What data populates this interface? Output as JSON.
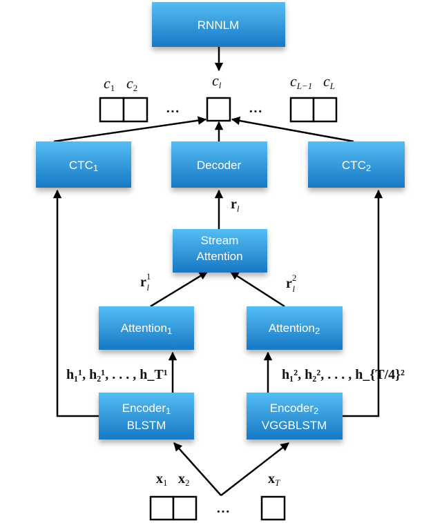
{
  "colors": {
    "box_top": "#55bdf2",
    "box_bottom": "#1778c4",
    "line": "#000000"
  },
  "boxes": {
    "rnnlm": "RNNLM",
    "ctc1": {
      "base": "CTC",
      "sub": "1"
    },
    "decoder": "Decoder",
    "ctc2": {
      "base": "CTC",
      "sub": "2"
    },
    "stream_attention": [
      "Stream",
      "Attention"
    ],
    "attention1": {
      "base": "Attention",
      "sub": "1"
    },
    "attention2": {
      "base": "Attention",
      "sub": "2"
    },
    "encoder1": {
      "base": "Encoder",
      "sub": "1",
      "line2": "BLSTM"
    },
    "encoder2": {
      "base": "Encoder",
      "sub": "2",
      "line2": "VGGBLSTM"
    }
  },
  "outputs": {
    "c1": {
      "b": "c",
      "s": "1"
    },
    "c2": {
      "b": "c",
      "s": "2"
    },
    "cl": {
      "b": "c",
      "s": "l"
    },
    "cL1": {
      "b": "c",
      "s": "L−1"
    },
    "cL": {
      "b": "c",
      "s": "L"
    },
    "ellipsis": "···"
  },
  "labels": {
    "rl": {
      "b": "r",
      "s": "l"
    },
    "rl1": {
      "b": "r",
      "s": "l",
      "p": "1"
    },
    "rl2": {
      "b": "r",
      "s": "l",
      "p": "2"
    },
    "h1": "h₁¹, h₂¹, . . . , h_T¹",
    "h2": "h₁², h₂², . . . , h_{T/4}²"
  },
  "inputs": {
    "x1": {
      "b": "x",
      "s": "1"
    },
    "x2": {
      "b": "x",
      "s": "2"
    },
    "xT": {
      "b": "x",
      "s": "T"
    },
    "ellipsis": "···"
  }
}
